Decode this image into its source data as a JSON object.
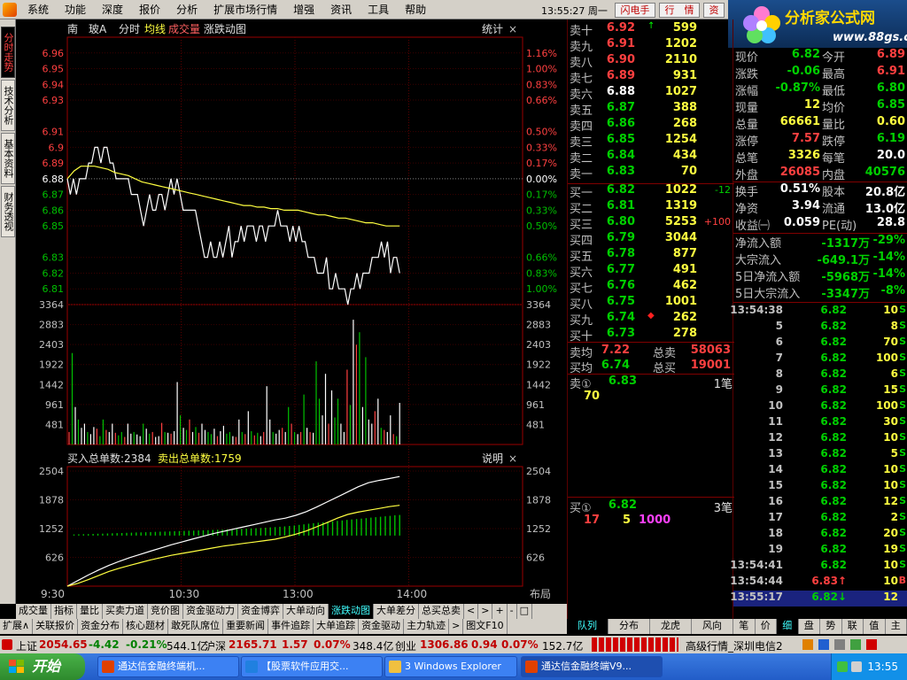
{
  "menu": {
    "items": [
      "系统",
      "功能",
      "深度",
      "报价",
      "分析",
      "扩展市场行情",
      "增强",
      "资讯",
      "工具",
      "帮助"
    ],
    "clock": "13:55:27 周一",
    "buttons": [
      "闪电手",
      "行　情",
      "资"
    ]
  },
  "brand": {
    "name": "分析家公式网",
    "url": "www.88gs.com"
  },
  "left_tabs": [
    "分时走势",
    "技术分析",
    "基本资料",
    "财务透视"
  ],
  "chart_header": {
    "stock": "南　玻A",
    "items": [
      "分时",
      "均线",
      "成交量",
      "涨跌动图"
    ],
    "stat": "统计"
  },
  "chart_data": [
    {
      "type": "line",
      "title": "分时走势",
      "x": [
        "9:30",
        "10:30",
        "13:00",
        "14:00"
      ],
      "price_ticks": [
        6.96,
        6.95,
        6.94,
        6.93,
        6.91,
        6.9,
        6.89,
        6.88,
        6.87,
        6.86,
        6.85,
        6.83,
        6.82,
        6.81
      ],
      "pct_ticks": [
        "1.16%",
        "1.00%",
        "0.83%",
        "0.66%",
        "0.50%",
        "0.33%",
        "0.17%",
        "0.00%",
        "0.17%",
        "0.33%",
        "0.50%",
        "0.66%",
        "0.83%",
        "1.00%"
      ],
      "prev_close": 6.88,
      "ylim": [
        6.8,
        6.97
      ],
      "series": [
        {
          "name": "价格",
          "color": "#ffffff",
          "values": [
            6.88,
            6.87,
            6.88,
            6.87,
            6.88,
            6.88,
            6.88,
            6.89,
            6.89,
            6.9,
            6.9,
            6.89,
            6.9,
            6.9,
            6.89,
            6.89,
            6.88,
            6.88,
            6.88,
            6.88,
            6.88,
            6.87,
            6.87,
            6.87,
            6.86,
            6.85,
            6.86,
            6.87,
            6.86,
            6.86,
            6.87,
            6.87,
            6.86,
            6.87,
            6.88,
            6.87,
            6.88,
            6.87,
            6.86,
            6.86,
            6.86,
            6.86,
            6.86,
            6.85,
            6.84,
            6.83,
            6.83,
            6.84,
            6.83,
            6.83,
            6.84,
            6.83,
            6.84,
            6.85,
            6.83,
            6.84,
            6.84,
            6.85,
            6.84,
            6.85,
            6.85,
            6.85,
            6.84,
            6.85,
            6.85,
            6.84,
            6.85,
            6.85,
            6.85,
            6.86,
            6.85,
            6.85,
            6.85,
            6.84,
            6.85,
            6.84,
            6.85,
            6.84,
            6.84,
            6.83,
            6.83,
            6.83,
            6.82,
            6.82,
            6.82,
            6.83,
            6.81,
            6.81,
            6.82,
            6.81,
            6.81,
            6.81,
            6.8,
            6.81,
            6.81,
            6.82,
            6.81,
            6.82,
            6.82,
            6.82,
            6.83,
            6.83,
            6.83,
            6.84,
            6.83,
            6.84,
            6.82,
            6.83,
            6.83,
            6.82
          ]
        },
        {
          "name": "均价",
          "color": "#ffff40",
          "values": [
            6.88,
            6.885,
            6.888,
            6.888,
            6.888,
            6.887,
            6.886,
            6.884,
            6.883,
            6.882,
            6.88,
            6.878,
            6.877,
            6.876,
            6.875,
            6.874,
            6.873,
            6.872,
            6.871,
            6.87,
            6.869,
            6.868,
            6.867,
            6.866,
            6.865,
            6.864,
            6.863,
            6.863,
            6.862,
            6.862,
            6.861,
            6.861,
            6.86,
            6.86,
            6.86,
            6.859,
            6.858,
            6.857,
            6.857,
            6.856,
            6.855,
            6.855,
            6.854,
            6.853,
            6.852,
            6.852,
            6.851,
            6.85,
            6.85,
            6.85
          ]
        }
      ]
    },
    {
      "type": "bar",
      "title": "成交量",
      "ticks": [
        3364,
        2883,
        2403,
        1922,
        1442,
        961,
        481
      ],
      "ylim": [
        0,
        3364
      ],
      "values": [
        300,
        2200,
        900,
        600,
        400,
        500,
        300,
        250,
        420,
        380,
        200,
        600,
        350,
        300,
        500,
        280,
        220,
        300,
        180,
        500,
        260,
        300,
        240,
        200,
        500,
        380,
        260,
        300,
        180,
        200,
        520,
        300,
        280,
        260,
        320,
        1500,
        700,
        400,
        350,
        600,
        300,
        420,
        280,
        500,
        350,
        300,
        250,
        380,
        200,
        320,
        450,
        260,
        300,
        200,
        180,
        600,
        300,
        250,
        800,
        320,
        220,
        280,
        200,
        300,
        1400,
        600,
        300,
        260,
        350,
        400,
        300,
        900,
        500,
        300,
        250,
        300,
        1200,
        400,
        300,
        280,
        2000,
        1100,
        700,
        1700,
        500,
        1300,
        650,
        1100,
        500,
        300,
        1800,
        950,
        3000,
        2400,
        2700,
        900,
        2100,
        600,
        500,
        800,
        1100,
        400,
        350,
        300,
        700,
        250,
        200,
        1000
      ]
    },
    {
      "type": "line",
      "title": "买卖总单数",
      "legend": [
        "买入总单数:2384",
        "卖出总单数:1759"
      ],
      "ticks": [
        2504,
        1878,
        1252,
        626
      ],
      "ylim": [
        0,
        2600
      ],
      "series": [
        {
          "name": "买入总单数",
          "color": "#ffffff",
          "values": [
            0,
            120,
            240,
            350,
            450,
            540,
            620,
            690,
            760,
            830,
            900,
            960,
            1020,
            1080,
            1140,
            1190,
            1240,
            1290,
            1340,
            1390,
            1440,
            1480,
            1540,
            1620,
            1720,
            1830,
            1940,
            2050,
            2160,
            2250,
            2300,
            2340,
            2384
          ]
        },
        {
          "name": "卖出总单数",
          "color": "#ffff40",
          "values": [
            0,
            60,
            140,
            230,
            320,
            390,
            450,
            510,
            570,
            620,
            670,
            710,
            750,
            790,
            830,
            870,
            900,
            930,
            960,
            990,
            1020,
            1070,
            1130,
            1200,
            1290,
            1380,
            1480,
            1560,
            1610,
            1650,
            1690,
            1730,
            1759
          ]
        }
      ],
      "bars_color": "#00c000",
      "bars": [
        1125,
        1128,
        1130,
        1133,
        1136,
        1140,
        1143,
        1146,
        1150,
        1153,
        1156,
        1160,
        1163,
        1167,
        1170,
        1173,
        1177,
        1180,
        1184,
        1187,
        1190,
        1194,
        1197,
        1201,
        1205,
        1208,
        1212,
        1215,
        1218,
        1222,
        1226,
        1230,
        1234,
        1238,
        1242,
        1246,
        1250,
        1255,
        1260,
        1266,
        1272,
        1278,
        1285,
        1292,
        1300,
        1310,
        1320,
        1332,
        1345,
        1358,
        1370,
        1380,
        1390,
        1400,
        1410,
        1420,
        1430,
        1440,
        1450,
        1460,
        1470,
        1480,
        1490,
        1500,
        1510,
        1520,
        1530,
        1540,
        1548
      ]
    }
  ],
  "time_axis": {
    "labels": [
      "9:30",
      "10:30",
      "13:00",
      "14:00"
    ],
    "layout": "布局"
  },
  "panel_labels": {
    "desc": "说明"
  },
  "order_book": {
    "asks": [
      {
        "label": "卖十",
        "price": "6.92",
        "vol": "599",
        "mark": "↑"
      },
      {
        "label": "卖九",
        "price": "6.91",
        "vol": "1202"
      },
      {
        "label": "卖八",
        "price": "6.90",
        "vol": "2110"
      },
      {
        "label": "卖七",
        "price": "6.89",
        "vol": "931"
      },
      {
        "label": "卖六",
        "price": "6.88",
        "vol": "1027"
      },
      {
        "label": "卖五",
        "price": "6.87",
        "vol": "388"
      },
      {
        "label": "卖四",
        "price": "6.86",
        "vol": "268"
      },
      {
        "label": "卖三",
        "price": "6.85",
        "vol": "1254"
      },
      {
        "label": "卖二",
        "price": "6.84",
        "vol": "434"
      },
      {
        "label": "卖一",
        "price": "6.83",
        "vol": "70"
      }
    ],
    "bids": [
      {
        "label": "买一",
        "price": "6.82",
        "vol": "1022",
        "chg": "-12"
      },
      {
        "label": "买二",
        "price": "6.81",
        "vol": "1319"
      },
      {
        "label": "买三",
        "price": "6.80",
        "vol": "5253",
        "chg": "+100"
      },
      {
        "label": "买四",
        "price": "6.79",
        "vol": "3044"
      },
      {
        "label": "买五",
        "price": "6.78",
        "vol": "877"
      },
      {
        "label": "买六",
        "price": "6.77",
        "vol": "491"
      },
      {
        "label": "买七",
        "price": "6.76",
        "vol": "462"
      },
      {
        "label": "买八",
        "price": "6.75",
        "vol": "1001"
      },
      {
        "label": "买九",
        "price": "6.74",
        "vol": "262",
        "mark": "◆"
      },
      {
        "label": "买十",
        "price": "6.73",
        "vol": "278"
      }
    ],
    "avg_sell": {
      "label": "卖均",
      "price": "7.22",
      "total_label": "总卖",
      "total": "58063"
    },
    "avg_buy": {
      "label": "买均",
      "price": "6.74",
      "total_label": "总买",
      "total": "19001"
    },
    "sell1_queue": {
      "label": "卖①",
      "price": "6.83",
      "count": "1笔",
      "orders": [
        "70"
      ]
    },
    "buy1_queue": {
      "label": "买①",
      "price": "6.82",
      "count": "3笔",
      "orders": [
        "17",
        "5",
        "1000"
      ]
    }
  },
  "quote": {
    "rows": [
      {
        "k1": "现价",
        "v1": "6.82",
        "k2": "今开",
        "v2": "6.89"
      },
      {
        "k1": "涨跌",
        "v1": "-0.06",
        "k2": "最高",
        "v2": "6.91"
      },
      {
        "k1": "涨幅",
        "v1": "-0.87%",
        "k2": "最低",
        "v2": "6.80"
      },
      {
        "k1": "现量",
        "v1": "12",
        "k2": "均价",
        "v2": "6.85"
      },
      {
        "k1": "总量",
        "v1": "66661",
        "k2": "量比",
        "v2": "0.60"
      },
      {
        "k1": "涨停",
        "v1": "7.57",
        "k2": "跌停",
        "v2": "6.19"
      },
      {
        "k1": "总笔",
        "v1": "3326",
        "k2": "每笔",
        "v2": "20.0"
      },
      {
        "k1": "外盘",
        "v1": "26085",
        "k2": "内盘",
        "v2": "40576"
      }
    ],
    "rows2": [
      {
        "k1": "换手",
        "v1": "0.51%",
        "k2": "股本",
        "v2": "20.8亿"
      },
      {
        "k1": "净资",
        "v1": "3.94",
        "k2": "流通",
        "v2": "13.0亿"
      },
      {
        "k1": "收益㈠",
        "v1": "0.059",
        "k2": "PE(动)",
        "v2": "28.8"
      }
    ],
    "flows": [
      {
        "k": "净流入额",
        "v": "-1317万",
        "p": "-29%"
      },
      {
        "k": "大宗流入",
        "v": "-649.1万",
        "p": "-14%"
      },
      {
        "k": "5日净流入额",
        "v": "-5968万",
        "p": "-14%"
      },
      {
        "k": "5日大宗流入",
        "v": "-3347万",
        "p": "-8%"
      }
    ]
  },
  "ticks": [
    {
      "t": "13:54:38",
      "p": "6.82",
      "v": "10",
      "d": "S"
    },
    {
      "t": "5",
      "p": "6.82",
      "v": "8",
      "d": "S"
    },
    {
      "t": "6",
      "p": "6.82",
      "v": "70",
      "d": "S"
    },
    {
      "t": "7",
      "p": "6.82",
      "v": "100",
      "d": "S"
    },
    {
      "t": "8",
      "p": "6.82",
      "v": "6",
      "d": "S"
    },
    {
      "t": "9",
      "p": "6.82",
      "v": "15",
      "d": "S"
    },
    {
      "t": "10",
      "p": "6.82",
      "v": "100",
      "d": "S"
    },
    {
      "t": "11",
      "p": "6.82",
      "v": "30",
      "d": "S"
    },
    {
      "t": "12",
      "p": "6.82",
      "v": "10",
      "d": "S"
    },
    {
      "t": "13",
      "p": "6.82",
      "v": "5",
      "d": "S"
    },
    {
      "t": "14",
      "p": "6.82",
      "v": "10",
      "d": "S"
    },
    {
      "t": "15",
      "p": "6.82",
      "v": "10",
      "d": "S"
    },
    {
      "t": "16",
      "p": "6.82",
      "v": "12",
      "d": "S"
    },
    {
      "t": "17",
      "p": "6.82",
      "v": "2",
      "d": "S"
    },
    {
      "t": "18",
      "p": "6.82",
      "v": "20",
      "d": "S"
    },
    {
      "t": "19",
      "p": "6.82",
      "v": "19",
      "d": "S"
    },
    {
      "t": "13:54:41",
      "p": "6.82",
      "v": "10",
      "d": "S"
    },
    {
      "t": "13:54:44",
      "p": "6.83↑",
      "v": "10",
      "d": "B"
    },
    {
      "t": "13:55:17",
      "p": "6.82↓",
      "v": "12",
      "d": ""
    }
  ],
  "bottom_tabs": [
    "成交量",
    "指标",
    "量比",
    "买卖力道",
    "竞价图",
    "资金驱动力",
    "资金博弈",
    "大单动向",
    "涨跌动图",
    "大单差分",
    "总买总卖",
    "<",
    ">",
    "+",
    "-",
    "□"
  ],
  "bottom_tabs_active": "涨跌动图",
  "bottom_tabs2": [
    "扩展∧",
    "关联报价",
    "资金分布",
    "核心题材",
    "敢死队席位",
    "重要新闻",
    "事件追踪",
    "大单追踪",
    "资金驱动",
    "主力轨迹",
    ">",
    "图文F10"
  ],
  "right_tabs": [
    "队列",
    "分布",
    "龙虎",
    "风向"
  ],
  "right_tabs2": [
    "笔",
    "价",
    "细",
    "盘",
    "势",
    "联",
    "值",
    "主"
  ],
  "status": {
    "idx1_name": "上证",
    "idx1_val": "2054.65",
    "idx1_chg": "-4.42",
    "idx1_pct": "-0.21%",
    "idx1_amt": "544.1亿",
    "idx2_name": "沪深",
    "idx2_val": "2165.71",
    "idx2_chg": "1.57",
    "idx2_pct": "0.07%",
    "idx2_amt": "348.4亿",
    "idx3_name": "创业",
    "idx3_val": "1306.86",
    "idx3_chg": "0.94",
    "idx3_pct": "0.07%",
    "idx3_amt": "152.7亿",
    "conn": "高级行情_深圳电信2"
  },
  "taskbar": {
    "start": "开始",
    "tasks": [
      "通达信金融终端机...",
      "【股票软件应用交...",
      "3 Windows Explorer",
      "通达信金融终端V9..."
    ],
    "time": "13:55"
  }
}
